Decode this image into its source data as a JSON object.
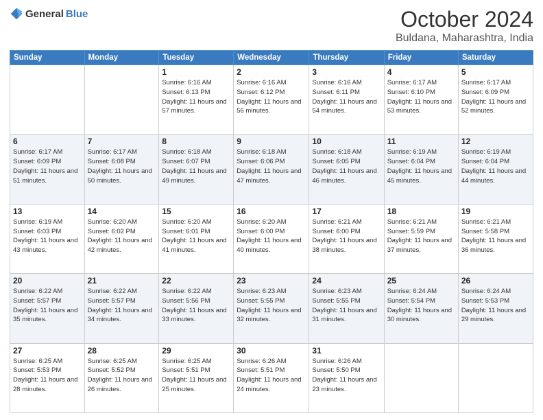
{
  "logo": {
    "general": "General",
    "blue": "Blue"
  },
  "header": {
    "month": "October 2024",
    "location": "Buldana, Maharashtra, India"
  },
  "weekdays": [
    "Sunday",
    "Monday",
    "Tuesday",
    "Wednesday",
    "Thursday",
    "Friday",
    "Saturday"
  ],
  "weeks": [
    [
      {
        "day": "",
        "sunrise": "",
        "sunset": "",
        "daylight": ""
      },
      {
        "day": "",
        "sunrise": "",
        "sunset": "",
        "daylight": ""
      },
      {
        "day": "1",
        "sunrise": "Sunrise: 6:16 AM",
        "sunset": "Sunset: 6:13 PM",
        "daylight": "Daylight: 11 hours and 57 minutes."
      },
      {
        "day": "2",
        "sunrise": "Sunrise: 6:16 AM",
        "sunset": "Sunset: 6:12 PM",
        "daylight": "Daylight: 11 hours and 56 minutes."
      },
      {
        "day": "3",
        "sunrise": "Sunrise: 6:16 AM",
        "sunset": "Sunset: 6:11 PM",
        "daylight": "Daylight: 11 hours and 54 minutes."
      },
      {
        "day": "4",
        "sunrise": "Sunrise: 6:17 AM",
        "sunset": "Sunset: 6:10 PM",
        "daylight": "Daylight: 11 hours and 53 minutes."
      },
      {
        "day": "5",
        "sunrise": "Sunrise: 6:17 AM",
        "sunset": "Sunset: 6:09 PM",
        "daylight": "Daylight: 11 hours and 52 minutes."
      }
    ],
    [
      {
        "day": "6",
        "sunrise": "Sunrise: 6:17 AM",
        "sunset": "Sunset: 6:09 PM",
        "daylight": "Daylight: 11 hours and 51 minutes."
      },
      {
        "day": "7",
        "sunrise": "Sunrise: 6:17 AM",
        "sunset": "Sunset: 6:08 PM",
        "daylight": "Daylight: 11 hours and 50 minutes."
      },
      {
        "day": "8",
        "sunrise": "Sunrise: 6:18 AM",
        "sunset": "Sunset: 6:07 PM",
        "daylight": "Daylight: 11 hours and 49 minutes."
      },
      {
        "day": "9",
        "sunrise": "Sunrise: 6:18 AM",
        "sunset": "Sunset: 6:06 PM",
        "daylight": "Daylight: 11 hours and 47 minutes."
      },
      {
        "day": "10",
        "sunrise": "Sunrise: 6:18 AM",
        "sunset": "Sunset: 6:05 PM",
        "daylight": "Daylight: 11 hours and 46 minutes."
      },
      {
        "day": "11",
        "sunrise": "Sunrise: 6:19 AM",
        "sunset": "Sunset: 6:04 PM",
        "daylight": "Daylight: 11 hours and 45 minutes."
      },
      {
        "day": "12",
        "sunrise": "Sunrise: 6:19 AM",
        "sunset": "Sunset: 6:04 PM",
        "daylight": "Daylight: 11 hours and 44 minutes."
      }
    ],
    [
      {
        "day": "13",
        "sunrise": "Sunrise: 6:19 AM",
        "sunset": "Sunset: 6:03 PM",
        "daylight": "Daylight: 11 hours and 43 minutes."
      },
      {
        "day": "14",
        "sunrise": "Sunrise: 6:20 AM",
        "sunset": "Sunset: 6:02 PM",
        "daylight": "Daylight: 11 hours and 42 minutes."
      },
      {
        "day": "15",
        "sunrise": "Sunrise: 6:20 AM",
        "sunset": "Sunset: 6:01 PM",
        "daylight": "Daylight: 11 hours and 41 minutes."
      },
      {
        "day": "16",
        "sunrise": "Sunrise: 6:20 AM",
        "sunset": "Sunset: 6:00 PM",
        "daylight": "Daylight: 11 hours and 40 minutes."
      },
      {
        "day": "17",
        "sunrise": "Sunrise: 6:21 AM",
        "sunset": "Sunset: 6:00 PM",
        "daylight": "Daylight: 11 hours and 38 minutes."
      },
      {
        "day": "18",
        "sunrise": "Sunrise: 6:21 AM",
        "sunset": "Sunset: 5:59 PM",
        "daylight": "Daylight: 11 hours and 37 minutes."
      },
      {
        "day": "19",
        "sunrise": "Sunrise: 6:21 AM",
        "sunset": "Sunset: 5:58 PM",
        "daylight": "Daylight: 11 hours and 36 minutes."
      }
    ],
    [
      {
        "day": "20",
        "sunrise": "Sunrise: 6:22 AM",
        "sunset": "Sunset: 5:57 PM",
        "daylight": "Daylight: 11 hours and 35 minutes."
      },
      {
        "day": "21",
        "sunrise": "Sunrise: 6:22 AM",
        "sunset": "Sunset: 5:57 PM",
        "daylight": "Daylight: 11 hours and 34 minutes."
      },
      {
        "day": "22",
        "sunrise": "Sunrise: 6:22 AM",
        "sunset": "Sunset: 5:56 PM",
        "daylight": "Daylight: 11 hours and 33 minutes."
      },
      {
        "day": "23",
        "sunrise": "Sunrise: 6:23 AM",
        "sunset": "Sunset: 5:55 PM",
        "daylight": "Daylight: 11 hours and 32 minutes."
      },
      {
        "day": "24",
        "sunrise": "Sunrise: 6:23 AM",
        "sunset": "Sunset: 5:55 PM",
        "daylight": "Daylight: 11 hours and 31 minutes."
      },
      {
        "day": "25",
        "sunrise": "Sunrise: 6:24 AM",
        "sunset": "Sunset: 5:54 PM",
        "daylight": "Daylight: 11 hours and 30 minutes."
      },
      {
        "day": "26",
        "sunrise": "Sunrise: 6:24 AM",
        "sunset": "Sunset: 5:53 PM",
        "daylight": "Daylight: 11 hours and 29 minutes."
      }
    ],
    [
      {
        "day": "27",
        "sunrise": "Sunrise: 6:25 AM",
        "sunset": "Sunset: 5:53 PM",
        "daylight": "Daylight: 11 hours and 28 minutes."
      },
      {
        "day": "28",
        "sunrise": "Sunrise: 6:25 AM",
        "sunset": "Sunset: 5:52 PM",
        "daylight": "Daylight: 11 hours and 26 minutes."
      },
      {
        "day": "29",
        "sunrise": "Sunrise: 6:25 AM",
        "sunset": "Sunset: 5:51 PM",
        "daylight": "Daylight: 11 hours and 25 minutes."
      },
      {
        "day": "30",
        "sunrise": "Sunrise: 6:26 AM",
        "sunset": "Sunset: 5:51 PM",
        "daylight": "Daylight: 11 hours and 24 minutes."
      },
      {
        "day": "31",
        "sunrise": "Sunrise: 6:26 AM",
        "sunset": "Sunset: 5:50 PM",
        "daylight": "Daylight: 11 hours and 23 minutes."
      },
      {
        "day": "",
        "sunrise": "",
        "sunset": "",
        "daylight": ""
      },
      {
        "day": "",
        "sunrise": "",
        "sunset": "",
        "daylight": ""
      }
    ]
  ]
}
